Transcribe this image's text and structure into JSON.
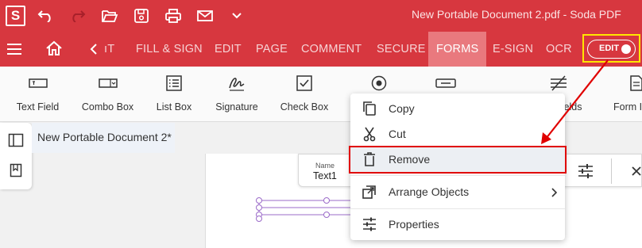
{
  "app": {
    "logo_letter": "S"
  },
  "titlebar": {
    "document_title": "New Portable Document 2.pdf  -  Soda PDF",
    "icons": [
      "undo-icon",
      "redo-icon",
      "open-folder-icon",
      "save-icon",
      "print-icon",
      "email-icon",
      "chevron-down-icon"
    ]
  },
  "menubar": {
    "tabs": [
      {
        "label": "ıT",
        "active": false
      },
      {
        "label": "FILL & SIGN",
        "active": false
      },
      {
        "label": "EDIT",
        "active": false
      },
      {
        "label": "PAGE",
        "active": false
      },
      {
        "label": "COMMENT",
        "active": false
      },
      {
        "label": "SECURE",
        "active": false
      },
      {
        "label": "FORMS",
        "active": true
      },
      {
        "label": "E-SIGN",
        "active": false
      },
      {
        "label": "OCR",
        "active": false
      }
    ],
    "edit_toggle_label": "EDIT"
  },
  "ribbon": {
    "items": [
      {
        "label": "Text Field",
        "icon": "text-field-icon"
      },
      {
        "label": "Combo Box",
        "icon": "combo-box-icon"
      },
      {
        "label": "List Box",
        "icon": "list-box-icon"
      },
      {
        "label": "Signature",
        "icon": "signature-icon"
      },
      {
        "label": "Check Box",
        "icon": "check-box-icon"
      },
      {
        "label": "",
        "icon": "radio-button-icon"
      },
      {
        "label": "",
        "icon": "button-field-icon"
      },
      {
        "label": "elds",
        "icon": "fields-icon"
      },
      {
        "label": "Form I",
        "icon": "form-icon"
      }
    ]
  },
  "document_tab": {
    "label": "New Portable Document 2*"
  },
  "field_properties_bar": {
    "name_label": "Name",
    "name_value": "Text1"
  },
  "context_menu": {
    "items": [
      {
        "label": "Copy",
        "icon": "copy-icon"
      },
      {
        "label": "Cut",
        "icon": "cut-icon"
      },
      {
        "label": "Remove",
        "icon": "trash-icon"
      },
      {
        "label": "Arrange Objects",
        "icon": "arrange-objects-icon",
        "submenu": true
      },
      {
        "label": "Properties",
        "icon": "properties-icon"
      }
    ]
  },
  "colors": {
    "brand_red": "#d7373f",
    "active_tab": "#e9797e",
    "highlight_yellow": "#ffe600",
    "annotation_red": "#e00000"
  }
}
